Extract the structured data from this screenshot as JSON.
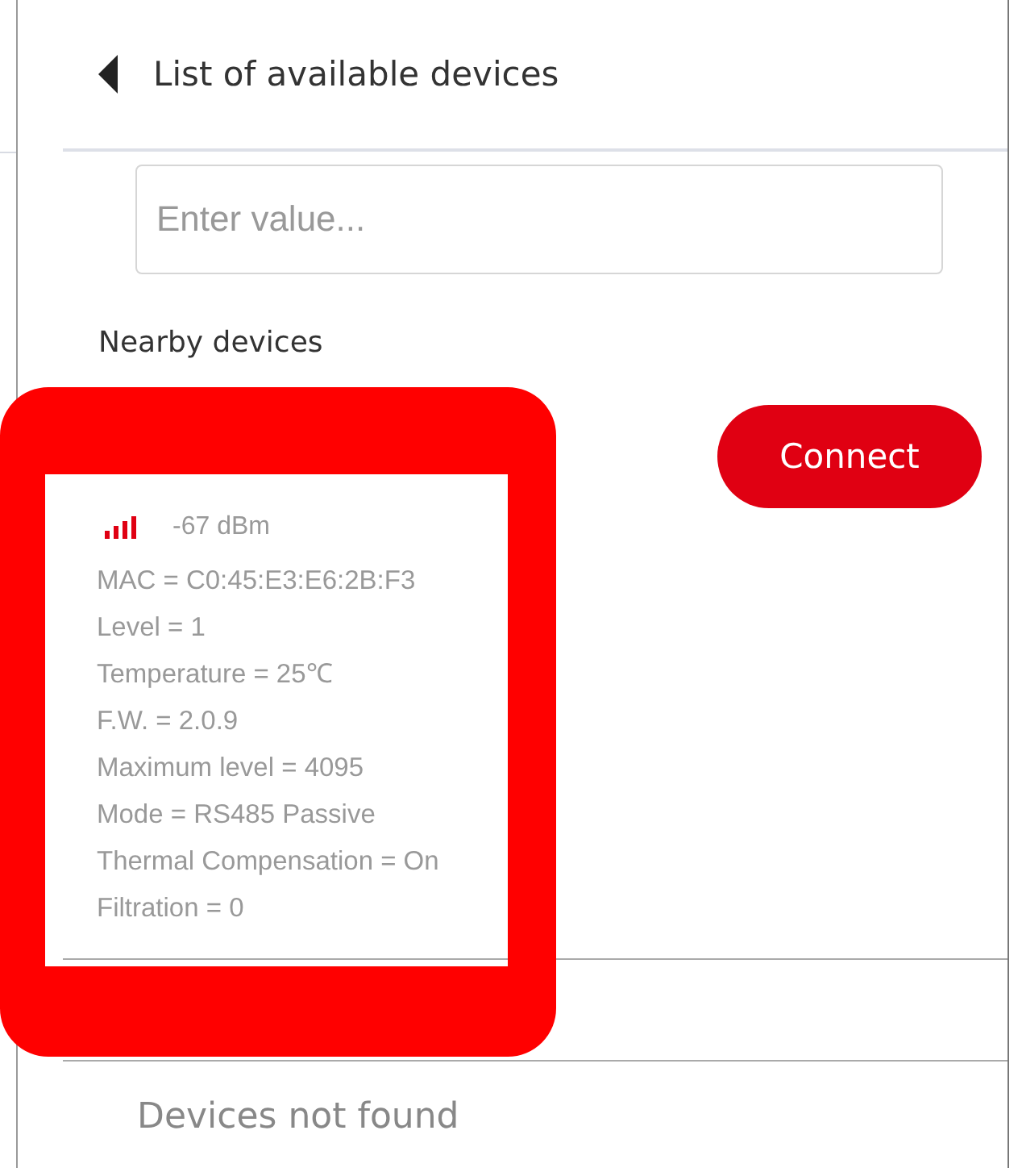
{
  "header": {
    "title": "List of available devices"
  },
  "search": {
    "placeholder": "Enter value..."
  },
  "section_label": "Nearby devices",
  "devices": [
    {
      "signal": "-67 dBm",
      "details": [
        "MAC = C0:45:E3:E6:2B:F3",
        "Level = 1",
        "Temperature = 25℃",
        "F.W. = 2.0.9",
        "Maximum level = 4095",
        "Mode = RS485 Passive",
        "Thermal Compensation = On",
        "Filtration = 0"
      ],
      "button": "Connect"
    }
  ],
  "empty_message": "Devices not found"
}
